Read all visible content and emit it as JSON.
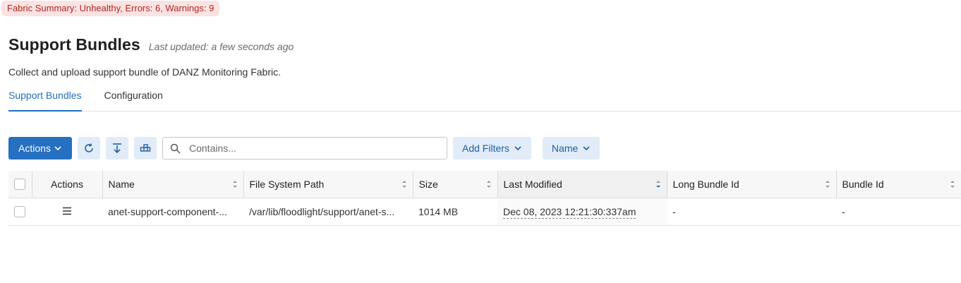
{
  "fabric_summary": "Fabric Summary: Unhealthy, Errors: 6, Warnings: 9",
  "header": {
    "title": "Support Bundles",
    "last_updated": "Last updated: a few seconds ago",
    "description": "Collect and upload support bundle of DANZ Monitoring Fabric."
  },
  "tabs": [
    {
      "label": "Support Bundles",
      "active": true
    },
    {
      "label": "Configuration",
      "active": false
    }
  ],
  "toolbar": {
    "actions_label": "Actions",
    "search_placeholder": "Contains...",
    "add_filters_label": "Add Filters",
    "name_label": "Name",
    "icons": [
      "refresh-icon",
      "download-icon",
      "columns-icon",
      "search-icon",
      "chevron-down-icon"
    ]
  },
  "table": {
    "columns": [
      "Actions",
      "Name",
      "File System Path",
      "Size",
      "Last Modified",
      "Long Bundle Id",
      "Bundle Id"
    ],
    "sorted_column": "Last Modified",
    "rows": [
      {
        "name": "anet-support-component-...",
        "path": "/var/lib/floodlight/support/anet-s...",
        "size": "1014 MB",
        "last_modified": "Dec 08, 2023 12:21:30:337am",
        "long_bundle_id": "-",
        "bundle_id": "-"
      }
    ]
  },
  "colors": {
    "primary": "#2670c2",
    "accent_light": "#e1ecf8",
    "error_bg": "#fbe3e3",
    "error_text": "#b3261e"
  }
}
